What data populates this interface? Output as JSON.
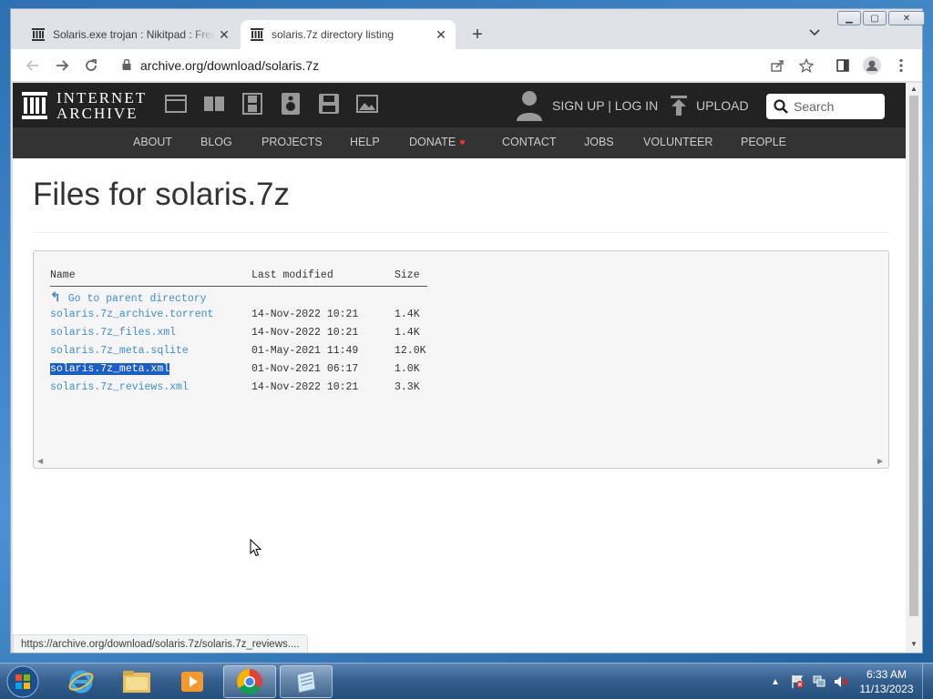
{
  "browser": {
    "tabs": [
      {
        "title": "Solaris.exe trojan : Nikitpad : Free",
        "active": false
      },
      {
        "title": "solaris.7z directory listing",
        "active": true
      }
    ],
    "url": "archive.org/download/solaris.7z",
    "status_url": "https://archive.org/download/solaris.7z/solaris.7z_reviews...."
  },
  "ia_header": {
    "logo_line1": "INTERNET",
    "logo_line2": "ARCHIVE",
    "signup_login": "SIGN UP | LOG IN",
    "upload": "UPLOAD",
    "search_placeholder": "Search",
    "nav": [
      "ABOUT",
      "BLOG",
      "PROJECTS",
      "HELP",
      "DONATE",
      "CONTACT",
      "JOBS",
      "VOLUNTEER",
      "PEOPLE"
    ]
  },
  "page": {
    "title": "Files for solaris.7z",
    "columns": [
      "Name",
      "Last modified",
      "Size"
    ],
    "parent_link": "Go to parent directory",
    "files": [
      {
        "name": "solaris.7z_archive.torrent",
        "modified": "14-Nov-2022 10:21",
        "size": "1.4K"
      },
      {
        "name": "solaris.7z_files.xml",
        "modified": "14-Nov-2022 10:21",
        "size": "1.4K"
      },
      {
        "name": "solaris.7z_meta.sqlite",
        "modified": "01-May-2021 11:49",
        "size": "12.0K"
      },
      {
        "name": "solaris.7z_meta.xml",
        "modified": "01-Nov-2021 06:17",
        "size": "1.0K",
        "selected": true
      },
      {
        "name": "solaris.7z_reviews.xml",
        "modified": "14-Nov-2022 10:21",
        "size": "3.3K"
      }
    ]
  },
  "taskbar": {
    "time": "6:33 AM",
    "date": "11/13/2023"
  },
  "colors": {
    "link": "#428bca",
    "selection": "#1a5ec8",
    "ia_header": "#222222",
    "ia_nav": "#333333",
    "donate_heart": "#ee3333"
  }
}
